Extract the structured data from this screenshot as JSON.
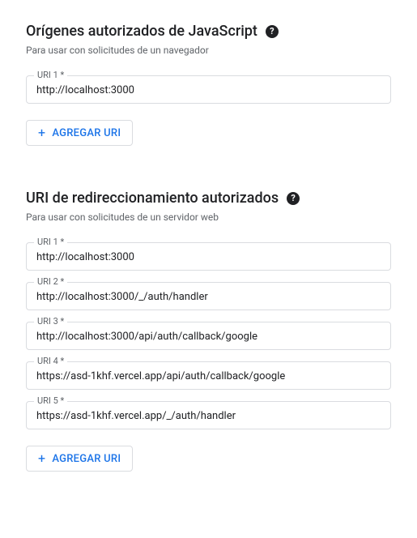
{
  "sections": {
    "origins": {
      "title": "Orígenes autorizados de JavaScript",
      "subtitle": "Para usar con solicitudes de un navegador",
      "fields": [
        {
          "label": "URI 1 *",
          "value": "http://localhost:3000"
        }
      ],
      "addButton": "AGREGAR URI"
    },
    "redirects": {
      "title": "URI de redireccionamiento autorizados",
      "subtitle": "Para usar con solicitudes de un servidor web",
      "fields": [
        {
          "label": "URI 1 *",
          "value": "http://localhost:3000"
        },
        {
          "label": "URI 2 *",
          "value": "http://localhost:3000/_/auth/handler"
        },
        {
          "label": "URI 3 *",
          "value": "http://localhost:3000/api/auth/callback/google"
        },
        {
          "label": "URI 4 *",
          "value": "https://asd-1khf.vercel.app/api/auth/callback/google"
        },
        {
          "label": "URI 5 *",
          "value": "https://asd-1khf.vercel.app/_/auth/handler"
        }
      ],
      "addButton": "AGREGAR URI"
    }
  },
  "helpGlyph": "?"
}
